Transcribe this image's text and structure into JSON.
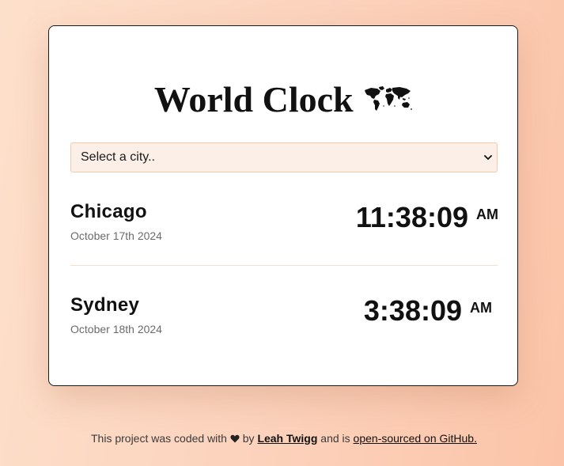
{
  "app": {
    "title": "World Clock",
    "icon": "world-map-icon"
  },
  "city_select": {
    "selected": "Select a city..",
    "icon": "chevron-down-icon"
  },
  "cities": [
    {
      "name": "Chicago",
      "date": "October 17th 2024",
      "time": "11:38:09",
      "ampm": "AM"
    },
    {
      "name": "Sydney",
      "date": "October 18th 2024",
      "time": "3:38:09",
      "ampm": "AM"
    }
  ],
  "footer": {
    "prefix": "This project was coded with",
    "heart_icon": "heart-icon",
    "by": "by",
    "author": "Leah Twigg",
    "middle": "and is",
    "repo_link": "open-sourced on GitHub."
  },
  "colors": {
    "background_start": "#fde0cb",
    "background_end": "#fbc4a8",
    "select_bg": "#fcefe8",
    "select_border": "#f3c9a8",
    "divider": "#f4ddcc",
    "text": "#111111",
    "muted": "#6b6b6b"
  }
}
